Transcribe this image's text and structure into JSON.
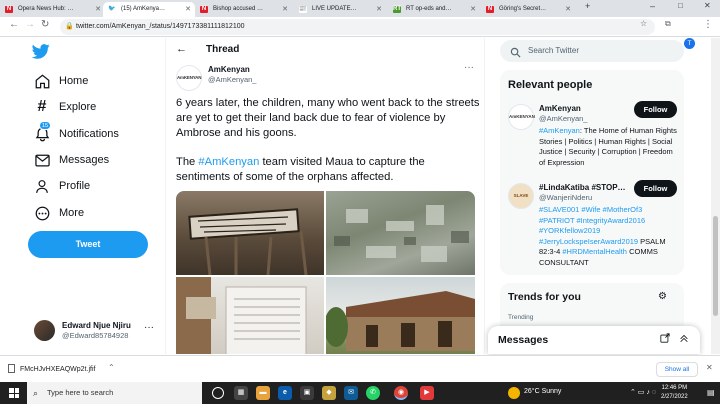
{
  "browser": {
    "tabs": [
      {
        "title": "Opera News Hub: Cre",
        "favicon": "opera-news-icon",
        "color": "#e31e2a",
        "active": false
      },
      {
        "title": "(15) AmKenyan on Tw",
        "favicon": "twitter-icon",
        "color": "#1d9bf0",
        "active": true
      },
      {
        "title": "Bishop accused of us",
        "favicon": "opera-news-icon",
        "color": "#e31e2a",
        "active": false
      },
      {
        "title": "LIVE UPDATES: Ukrain",
        "favicon": "news-icon",
        "color": "#e31e2a",
        "active": false
      },
      {
        "title": "RT op-eds and featur",
        "favicon": "rt-icon",
        "color": "#4a9b2e",
        "active": false
      },
      {
        "title": "Göring's Secret - The",
        "favicon": "opera-news-icon",
        "color": "#e31e2a",
        "active": false
      }
    ],
    "url": "twitter.com/AmKenyan_/status/1497173381111812100",
    "new_tab": "+",
    "window_controls": {
      "minimize": "–",
      "maximize": "□",
      "close": "✕"
    }
  },
  "nav": {
    "items": [
      {
        "label": "Home",
        "icon": "home-icon"
      },
      {
        "label": "Explore",
        "icon": "hashtag-icon"
      },
      {
        "label": "Notifications",
        "icon": "bell-icon",
        "badge": "15"
      },
      {
        "label": "Messages",
        "icon": "envelope-icon"
      },
      {
        "label": "Profile",
        "icon": "person-icon"
      },
      {
        "label": "More",
        "icon": "more-circle-icon"
      }
    ],
    "tweet_button": "Tweet",
    "profile": {
      "name": "Edward Njue Njiru",
      "handle": "@Edward85784928",
      "more": "···"
    }
  },
  "thread": {
    "header": "Thread",
    "author": {
      "name": "AmKenyan",
      "handle": "@AmKenyan_",
      "avatar_text": "AmKENYAN"
    },
    "more": "···",
    "paragraph1": "6 years later, the children, many who went back to the streets are yet to get their land back due to fear of violence by Ambrose and his goons.",
    "paragraph2_pre": "The ",
    "paragraph2_hashtag": "#AmKenyan",
    "paragraph2_post": " team visited Maua to capture the sentiments of some of the orphans affected."
  },
  "sidebar": {
    "search_placeholder": "Search Twitter",
    "relevant_title": "Relevant people",
    "people": [
      {
        "name": "AmKenyan",
        "handle": "@AmKenyan_",
        "avatar_text": "AmKENYAN",
        "bio_hashtag": "#AmKenyan",
        "bio_rest": ": The Home of Human Rights Stories | Politics | Human Rights | Social Justice | Security | Corruption | Freedom of Expression",
        "follow": "Follow"
      },
      {
        "name": "#LindaKatiba #STOP…",
        "handle": "@WanjeriNderu",
        "avatar_text": "SLAVE",
        "bio_tags": "#SLAVE001 #Wife #MotherOf3 #PATRIOT #IntegrityAward2016 #YORKfellow2019 #JerryLockspeIserAward2019",
        "bio_plain": " PSALM 82:3-4 ",
        "bio_tag2": "#HRDMentalHealth",
        "bio_end": " COMMS CONSULTANT",
        "follow": "Follow"
      }
    ],
    "trends_title": "Trends for you",
    "trend_category": "Trending",
    "messages_title": "Messages"
  },
  "downloads": {
    "file": "FMcHJvHXEAQWp2t.jfif",
    "show_all": "Show all",
    "close": "✕"
  },
  "taskbar": {
    "search_placeholder": "Type here to search",
    "weather": "26°C  Sunny",
    "time": "12:46 PM",
    "date": "2/27/2022"
  }
}
